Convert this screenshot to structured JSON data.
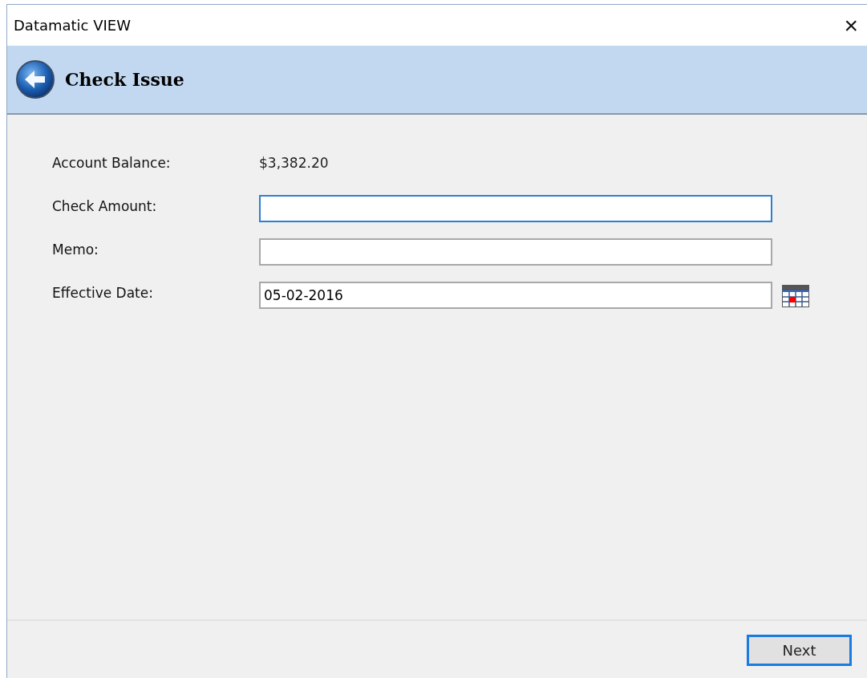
{
  "window": {
    "title": "Datamatic VIEW",
    "close": "×"
  },
  "header": {
    "title": "Check Issue"
  },
  "fields": [
    {
      "kind": "value",
      "label": "Account Balance:",
      "value": "$3,382.20"
    },
    {
      "kind": "input",
      "label": "Check Amount:",
      "focused": true
    },
    {
      "kind": "input",
      "label": "Memo:",
      "focused": false
    },
    {
      "kind": "date",
      "label": "Effective Date:",
      "value": "05-02-2016",
      "focused": false
    }
  ],
  "buttons": [
    {
      "label": "Next",
      "focused": true
    }
  ]
}
